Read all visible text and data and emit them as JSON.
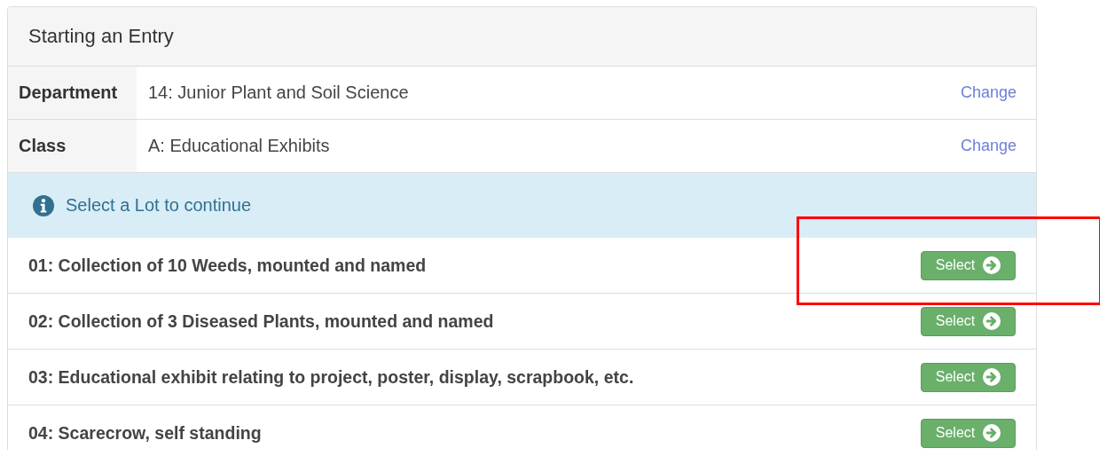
{
  "panel": {
    "title": "Starting an Entry"
  },
  "details": [
    {
      "label": "Department",
      "value": "14: Junior Plant and Soil Science",
      "action": "Change"
    },
    {
      "label": "Class",
      "value": "A: Educational Exhibits",
      "action": "Change"
    }
  ],
  "alert": {
    "text": "Select a Lot to continue"
  },
  "lots": [
    {
      "title": "01: Collection of 10 Weeds, mounted and named",
      "button": "Select",
      "highlighted": true
    },
    {
      "title": "02: Collection of 3 Diseased Plants, mounted and named",
      "button": "Select",
      "highlighted": false
    },
    {
      "title": "03: Educational exhibit relating to project, poster, display, scrapbook, etc.",
      "button": "Select",
      "highlighted": false
    },
    {
      "title": "04: Scarecrow, self standing",
      "button": "Select",
      "highlighted": false
    }
  ]
}
